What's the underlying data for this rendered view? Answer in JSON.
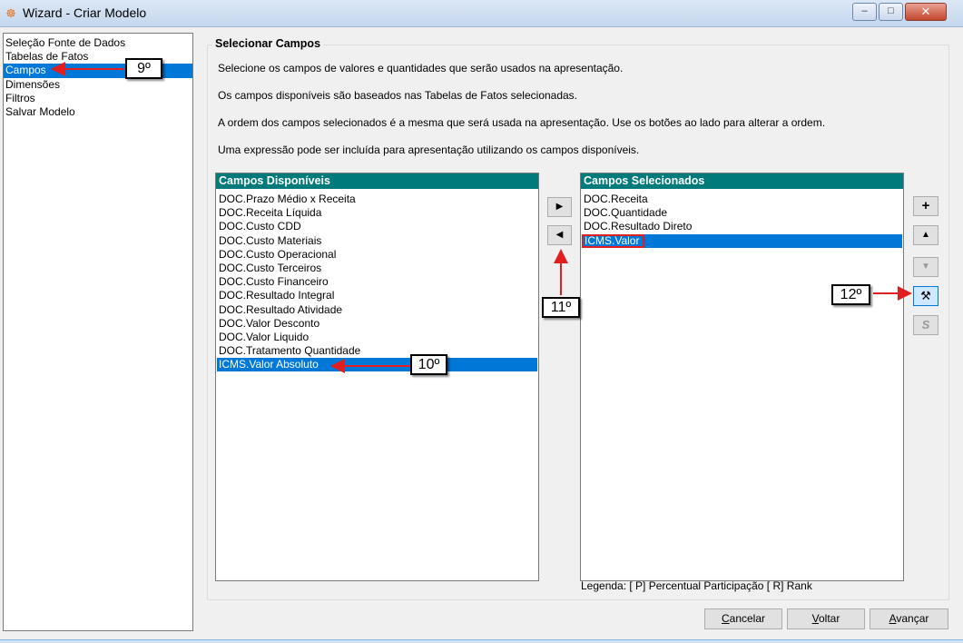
{
  "window": {
    "title": "Wizard - Criar Modelo",
    "app_icon": "wizard-app-icon",
    "controls": {
      "minimize": "–",
      "maximize": "□",
      "close": "✕"
    }
  },
  "nav": {
    "items": [
      {
        "label": "Seleção Fonte de Dados",
        "selected": false
      },
      {
        "label": "Tabelas de Fatos",
        "selected": false
      },
      {
        "label": "Campos",
        "selected": true
      },
      {
        "label": "Dimensões",
        "selected": false
      },
      {
        "label": "Filtros",
        "selected": false
      },
      {
        "label": "Salvar Modelo",
        "selected": false
      }
    ]
  },
  "panel": {
    "title": "Selecionar Campos",
    "instructions": [
      "Selecione os campos de valores e quantidades que serão usados na apresentação.",
      "Os campos disponíveis são baseados nas Tabelas de Fatos selecionadas.",
      "A ordem dos campos selecionados é a mesma que será usada na apresentação. Use os botões ao lado para alterar a ordem.",
      "Uma expressão pode ser incluída para apresentação utilizando os campos disponíveis."
    ]
  },
  "available": {
    "header": "Campos Disponíveis",
    "items": [
      "DOC.Prazo Médio x Receita",
      "DOC.Receita Líquida",
      "DOC.Custo CDD",
      "DOC.Custo Materiais",
      "DOC.Custo Operacional",
      "DOC.Custo Terceiros",
      "DOC.Custo Financeiro",
      "DOC.Resultado Integral",
      "DOC.Resultado Atividade",
      "DOC.Valor Desconto",
      "DOC.Valor Liquido",
      "DOC.Tratamento Quantidade",
      "ICMS.Valor Absoluto"
    ],
    "selected_index": 12
  },
  "selected_fields": {
    "header": "Campos Selecionados",
    "items": [
      "DOC.Receita",
      "DOC.Quantidade",
      "DOC.Resultado Direto",
      "ICMS.Valor"
    ],
    "selected_index": 3
  },
  "move_buttons": {
    "add": "▶",
    "remove": "◀"
  },
  "side_buttons": {
    "add_expression": "+",
    "move_up": "▲",
    "move_down": "▼",
    "tools": "⚒",
    "s_label": "S"
  },
  "legend": "Legenda:   [ P] Percentual Participação   [ R] Rank",
  "footer": {
    "cancel_prefix": "",
    "cancel_accel": "C",
    "cancel_rest": "ancelar",
    "back_accel": "V",
    "back_rest": "oltar",
    "next_prefix": "",
    "next_accel": "A",
    "next_rest": "vançar"
  },
  "annotations": {
    "step9": "9º",
    "step10": "10º",
    "step11": "11º",
    "step12": "12º",
    "color": "#e02020"
  }
}
